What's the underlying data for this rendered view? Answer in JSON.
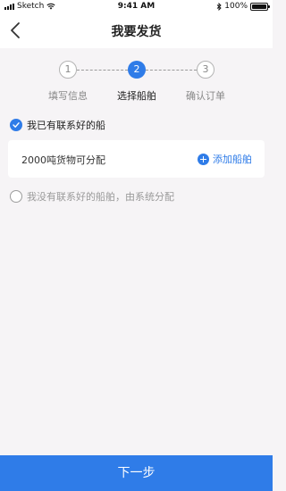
{
  "status_bar": {
    "carrier": "Sketch",
    "time": "9:41 AM",
    "battery": "100%",
    "battery_level": 1.0
  },
  "nav": {
    "title": "我要发货",
    "back_icon": "chevron-left-icon"
  },
  "steps": [
    {
      "number": "1",
      "label": "填写信息",
      "state": "done"
    },
    {
      "number": "2",
      "label": "选择船舶",
      "state": "active"
    },
    {
      "number": "3",
      "label": "确认订单",
      "state": "pending"
    }
  ],
  "option_has_ship": {
    "label": "我已有联系好的船",
    "checked": true
  },
  "cargo_card": {
    "text": "2000吨货物可分配",
    "add_label": "添加船舶"
  },
  "option_no_ship": {
    "label": "我没有联系好的船舶，由系统分配",
    "checked": false
  },
  "footer": {
    "next_label": "下一步"
  },
  "colors": {
    "accent": "#2f7ce8",
    "background": "#f6f4f6"
  }
}
